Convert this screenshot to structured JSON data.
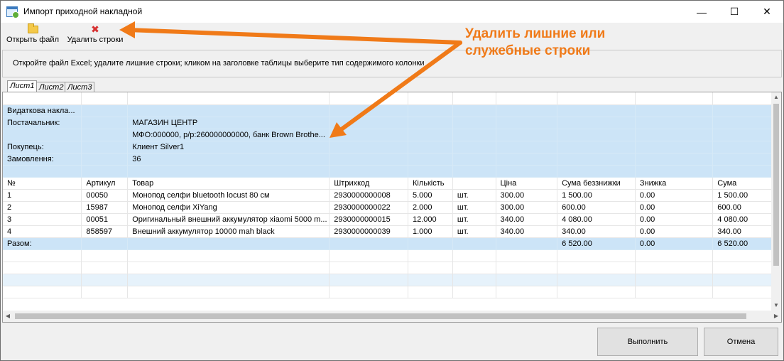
{
  "window": {
    "title": "Импорт приходной накладной",
    "controls": {
      "minimize": "—",
      "maximize": "☐",
      "close": "✕"
    }
  },
  "toolbar": {
    "open_label": "Открыть файл",
    "delete_label": "Удалить строки"
  },
  "hint": "Откройте файл Excel;  удалите лишние строки;  кликом на заголовке таблицы выберите тип содержимого колонки",
  "tabs": [
    "Лист1",
    "Лист2",
    "Лист3"
  ],
  "grid": {
    "rows": [
      [
        "",
        "",
        "",
        "",
        "",
        "",
        "",
        "",
        "",
        "",
        ""
      ],
      [
        "Видаткова накла...",
        "",
        "",
        "",
        "",
        "",
        "",
        "",
        "",
        "",
        ""
      ],
      [
        "Постачальник:",
        "",
        "МАГАЗИН ЦЕНТР",
        "",
        "",
        "",
        "",
        "",
        "",
        "",
        ""
      ],
      [
        "",
        "",
        "МФО:000000, р/р:260000000000, банк Brown Brothe...",
        "",
        "",
        "",
        "",
        "",
        "",
        "",
        ""
      ],
      [
        "Покупець:",
        "",
        "Клиент Silver1",
        "",
        "",
        "",
        "",
        "",
        "",
        "",
        ""
      ],
      [
        "Замовлення:",
        "",
        "36",
        "",
        "",
        "",
        "",
        "",
        "",
        "",
        ""
      ],
      [
        "",
        "",
        "",
        "",
        "",
        "",
        "",
        "",
        "",
        "",
        ""
      ],
      [
        "№",
        "Артикул",
        "Товар",
        "Штрихкод",
        "Кількість",
        "",
        "Ціна",
        "Сума беззнижки",
        "Знижка",
        "Сума",
        ""
      ],
      [
        "1",
        "00050",
        "Монопод селфи bluetooth locust 80 см",
        "2930000000008",
        "5.000",
        "шт.",
        "300.00",
        "1 500.00",
        "0.00",
        "1 500.00",
        ""
      ],
      [
        "2",
        "15987",
        "Монопод селфи XiYang",
        "2930000000022",
        "2.000",
        "шт.",
        "300.00",
        "600.00",
        "0.00",
        "600.00",
        ""
      ],
      [
        "3",
        "00051",
        "Оригинальный внешний аккумулятор xiaomi 5000 m...",
        "2930000000015",
        "12.000",
        "шт.",
        "340.00",
        "4 080.00",
        "0.00",
        "4 080.00",
        ""
      ],
      [
        "4",
        "858597",
        "Внешний аккумулятор 10000 mah black",
        "2930000000039",
        "1.000",
        "шт.",
        "340.00",
        "340.00",
        "0.00",
        "340.00",
        ""
      ],
      [
        "Разом:",
        "",
        "",
        "",
        "",
        "",
        "",
        "6 520.00",
        "0.00",
        "6 520.00",
        ""
      ],
      [
        "",
        "",
        "",
        "",
        "",
        "",
        "",
        "",
        "",
        "",
        ""
      ],
      [
        "",
        "",
        "",
        "",
        "",
        "",
        "",
        "",
        "",
        "",
        ""
      ],
      [
        "",
        "",
        "",
        "",
        "",
        "",
        "",
        "",
        "",
        "",
        ""
      ],
      [
        "",
        "",
        "",
        "",
        "",
        "",
        "",
        "",
        "",
        "",
        ""
      ]
    ],
    "row_styles": [
      "plain",
      "hl",
      "hl",
      "hl",
      "hl",
      "hl",
      "hl",
      "hdr",
      "plain",
      "plain",
      "plain",
      "plain",
      "hl",
      "plain",
      "plain",
      "lt",
      "plain"
    ]
  },
  "buttons": {
    "execute_label": "Выполнить",
    "cancel_label": "Отмена"
  },
  "annotation": {
    "line1": "Удалить лишние или",
    "line2": "служебные строки",
    "color": "#f07a18"
  },
  "icons": {
    "open": "folder-icon",
    "delete": "red-x-icon",
    "app": "app-icon"
  }
}
